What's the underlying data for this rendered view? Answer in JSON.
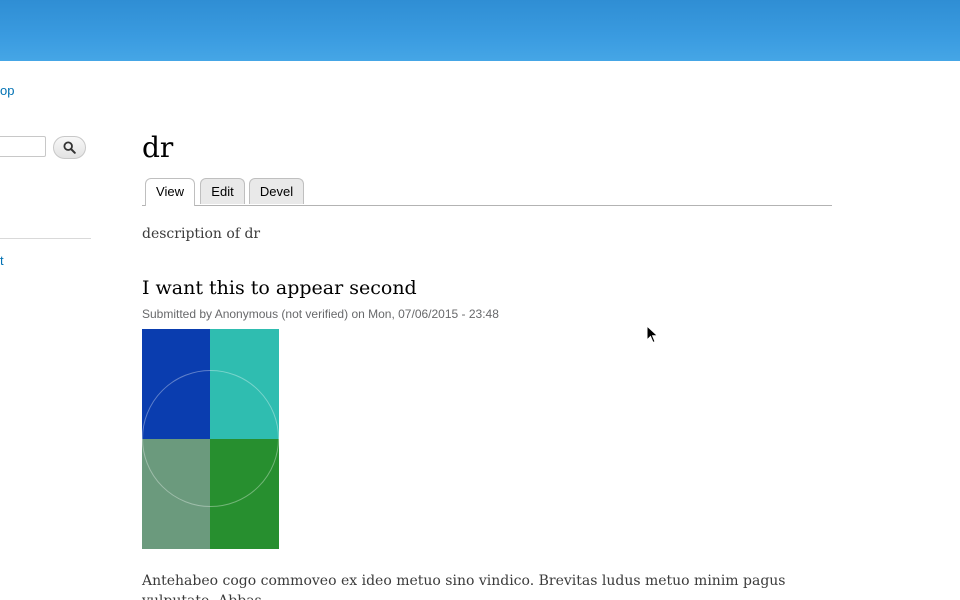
{
  "sidebar": {
    "top_link": "op",
    "search": {
      "value": "",
      "placeholder": ""
    },
    "search_button_icon": "search-icon",
    "second_link": "t"
  },
  "page": {
    "title": "dr",
    "tabs": [
      {
        "label": "View",
        "active": true
      },
      {
        "label": "Edit",
        "active": false
      },
      {
        "label": "Devel",
        "active": false
      }
    ],
    "description": "description of dr"
  },
  "node": {
    "title": "I want this to appear second",
    "submitted": "Submitted by Anonymous (not verified) on Mon, 07/06/2015 - 23:48",
    "image_colors": [
      "#0a3daf",
      "#2fbdb0",
      "#6b9a7d",
      "#278f2f"
    ],
    "body": "Antehabeo cogo commoveo ex ideo metuo sino vindico. Brevitas ludus metuo minim pagus vulputate. Abbas"
  },
  "colors": {
    "header": "#3a9be0",
    "link": "#0071b3"
  }
}
